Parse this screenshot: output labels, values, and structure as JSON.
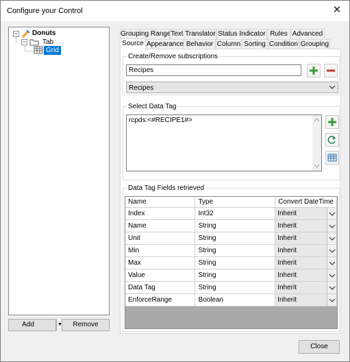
{
  "window": {
    "title": "Configure your Control",
    "close_symbol": "✕"
  },
  "tree": {
    "root": "Donuts",
    "child": "Tab",
    "grandchild": "Grid"
  },
  "footer": {
    "add_label": "Add",
    "remove_label": "Remove",
    "close_label": "Close"
  },
  "tabs": {
    "row1": [
      "Grouping Range",
      "Text Translator",
      "Status Indicator",
      "Rules",
      "Advanced"
    ],
    "row2": [
      "Source",
      "Appearance",
      "Behavior",
      "Column",
      "Sorting",
      "Condition",
      "Grouping"
    ],
    "active": "Source"
  },
  "subscriptions": {
    "legend": "Create/Remove subscriptions",
    "input_value": "Recipes",
    "combo_value": "Recipes"
  },
  "data_tag": {
    "legend": "Select Data Tag",
    "value": "rcpds:<#RECIPE1#>"
  },
  "fields": {
    "legend": "Data Tag Fields retrieved",
    "columns": [
      "Name",
      "Type",
      "Convert DateTime"
    ],
    "rows": [
      {
        "name": "Index",
        "type": "Int32",
        "convert": "Inherit"
      },
      {
        "name": "Name",
        "type": "String",
        "convert": "Inherit"
      },
      {
        "name": "Unit",
        "type": "String",
        "convert": "Inherit"
      },
      {
        "name": "Min",
        "type": "String",
        "convert": "Inherit"
      },
      {
        "name": "Max",
        "type": "String",
        "convert": "Inherit"
      },
      {
        "name": "Value",
        "type": "String",
        "convert": "Inherit"
      },
      {
        "name": "Data Tag",
        "type": "String",
        "convert": "Inherit"
      },
      {
        "name": "EnforceRange",
        "type": "Boolean",
        "convert": "Inherit"
      }
    ]
  },
  "colors": {
    "accent_green": "#3a9a3a",
    "accent_red": "#c0392b",
    "selection": "#0078d7"
  }
}
